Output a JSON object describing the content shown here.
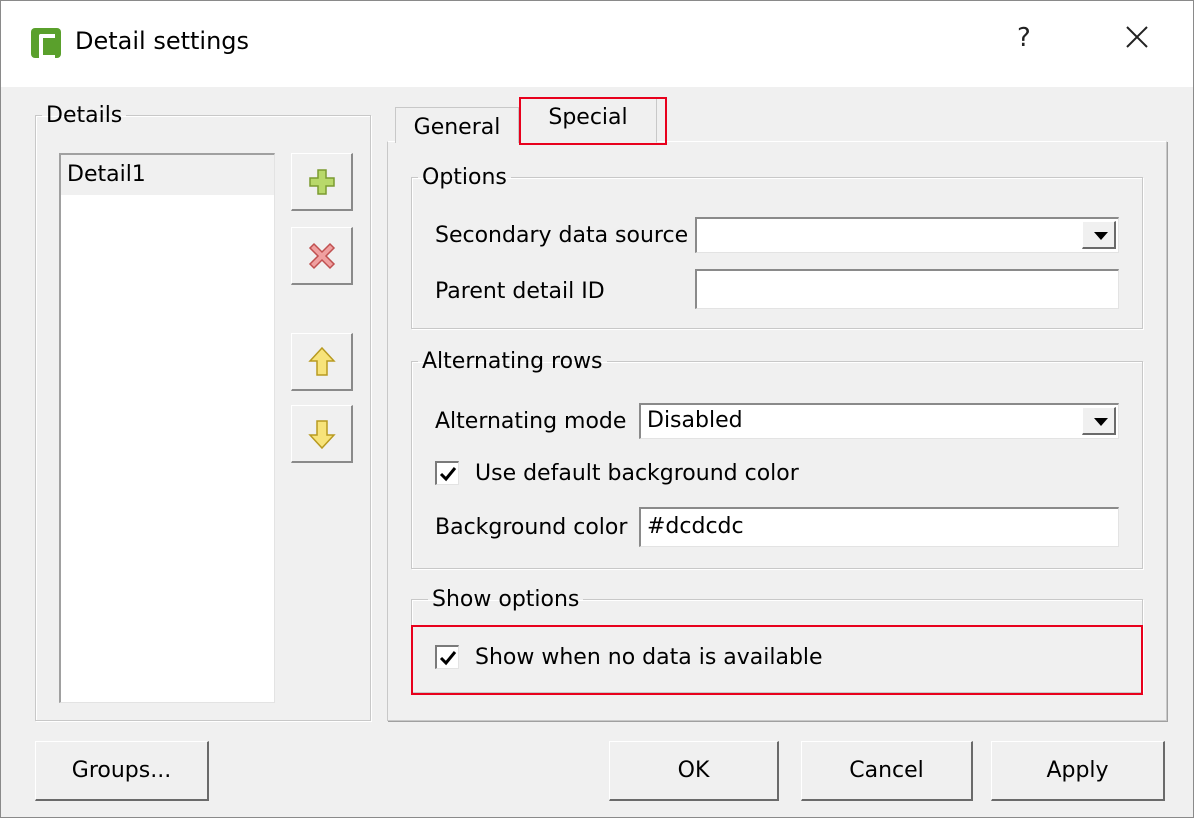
{
  "window": {
    "title": "Detail settings",
    "help_label": "?",
    "icons": {
      "app": "app-logo-icon",
      "close": "close-icon"
    }
  },
  "details": {
    "group_label": "Details",
    "items": [
      "Detail1"
    ],
    "buttons": {
      "add": "add-icon",
      "remove": "remove-icon",
      "move_up": "arrow-up-icon",
      "move_down": "arrow-down-icon"
    }
  },
  "tabs": [
    {
      "label": "General",
      "selected": false
    },
    {
      "label": "Special",
      "selected": true
    }
  ],
  "options": {
    "group_label": "Options",
    "secondary_source_label": "Secondary data source",
    "secondary_source_value": "",
    "parent_id_label": "Parent detail ID",
    "parent_id_value": ""
  },
  "alternating": {
    "group_label": "Alternating rows",
    "mode_label": "Alternating mode",
    "mode_value": "Disabled",
    "use_default_label": "Use default background color",
    "use_default_checked": true,
    "bg_color_label": "Background color",
    "bg_color_value": "#dcdcdc"
  },
  "show_options": {
    "group_label": "Show options",
    "show_no_data_label": "Show when no data is available",
    "show_no_data_checked": true
  },
  "footer": {
    "groups_label": "Groups...",
    "ok_label": "OK",
    "cancel_label": "Cancel",
    "apply_label": "Apply"
  },
  "colors": {
    "window_bg": "#f0f0f0",
    "highlight": "#e8001c",
    "brand": "#5aa02c"
  }
}
